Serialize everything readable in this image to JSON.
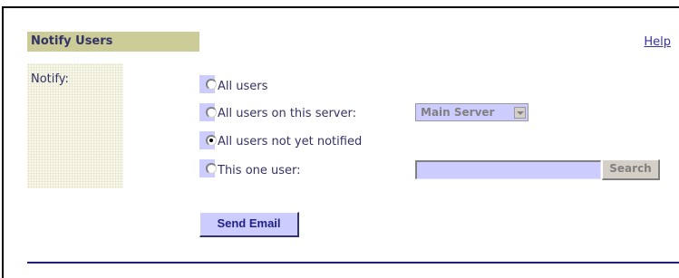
{
  "header": {
    "title": "Notify Users",
    "help_link": "Help"
  },
  "form": {
    "notify_label": "Notify:",
    "options": [
      {
        "label": "All users",
        "checked": false
      },
      {
        "label": "All users on this server:",
        "checked": false
      },
      {
        "label": "All users not yet notified",
        "checked": true
      },
      {
        "label": "This one user:",
        "checked": false
      }
    ],
    "server_select": {
      "selected": "Main Server"
    },
    "user_input": {
      "value": "",
      "placeholder": ""
    },
    "search_button": "Search",
    "send_button": "Send Email"
  },
  "colors": {
    "title_bar": "#cccc99",
    "field_bg": "#ccccff",
    "accent": "#1a1aa8",
    "text": "#333366"
  }
}
